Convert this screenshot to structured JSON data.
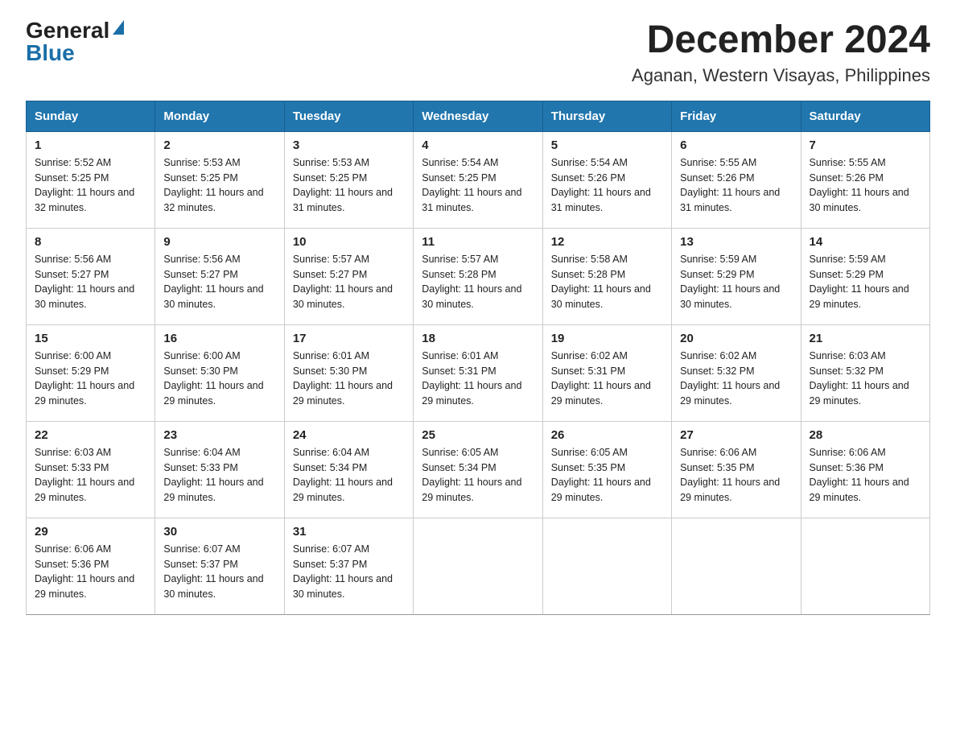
{
  "header": {
    "logo_general": "General",
    "logo_blue": "Blue",
    "title": "December 2024",
    "subtitle": "Aganan, Western Visayas, Philippines"
  },
  "weekdays": [
    "Sunday",
    "Monday",
    "Tuesday",
    "Wednesday",
    "Thursday",
    "Friday",
    "Saturday"
  ],
  "weeks": [
    [
      {
        "day": 1,
        "sunrise": "5:52 AM",
        "sunset": "5:25 PM",
        "daylight": "11 hours and 32 minutes."
      },
      {
        "day": 2,
        "sunrise": "5:53 AM",
        "sunset": "5:25 PM",
        "daylight": "11 hours and 32 minutes."
      },
      {
        "day": 3,
        "sunrise": "5:53 AM",
        "sunset": "5:25 PM",
        "daylight": "11 hours and 31 minutes."
      },
      {
        "day": 4,
        "sunrise": "5:54 AM",
        "sunset": "5:25 PM",
        "daylight": "11 hours and 31 minutes."
      },
      {
        "day": 5,
        "sunrise": "5:54 AM",
        "sunset": "5:26 PM",
        "daylight": "11 hours and 31 minutes."
      },
      {
        "day": 6,
        "sunrise": "5:55 AM",
        "sunset": "5:26 PM",
        "daylight": "11 hours and 31 minutes."
      },
      {
        "day": 7,
        "sunrise": "5:55 AM",
        "sunset": "5:26 PM",
        "daylight": "11 hours and 30 minutes."
      }
    ],
    [
      {
        "day": 8,
        "sunrise": "5:56 AM",
        "sunset": "5:27 PM",
        "daylight": "11 hours and 30 minutes."
      },
      {
        "day": 9,
        "sunrise": "5:56 AM",
        "sunset": "5:27 PM",
        "daylight": "11 hours and 30 minutes."
      },
      {
        "day": 10,
        "sunrise": "5:57 AM",
        "sunset": "5:27 PM",
        "daylight": "11 hours and 30 minutes."
      },
      {
        "day": 11,
        "sunrise": "5:57 AM",
        "sunset": "5:28 PM",
        "daylight": "11 hours and 30 minutes."
      },
      {
        "day": 12,
        "sunrise": "5:58 AM",
        "sunset": "5:28 PM",
        "daylight": "11 hours and 30 minutes."
      },
      {
        "day": 13,
        "sunrise": "5:59 AM",
        "sunset": "5:29 PM",
        "daylight": "11 hours and 30 minutes."
      },
      {
        "day": 14,
        "sunrise": "5:59 AM",
        "sunset": "5:29 PM",
        "daylight": "11 hours and 29 minutes."
      }
    ],
    [
      {
        "day": 15,
        "sunrise": "6:00 AM",
        "sunset": "5:29 PM",
        "daylight": "11 hours and 29 minutes."
      },
      {
        "day": 16,
        "sunrise": "6:00 AM",
        "sunset": "5:30 PM",
        "daylight": "11 hours and 29 minutes."
      },
      {
        "day": 17,
        "sunrise": "6:01 AM",
        "sunset": "5:30 PM",
        "daylight": "11 hours and 29 minutes."
      },
      {
        "day": 18,
        "sunrise": "6:01 AM",
        "sunset": "5:31 PM",
        "daylight": "11 hours and 29 minutes."
      },
      {
        "day": 19,
        "sunrise": "6:02 AM",
        "sunset": "5:31 PM",
        "daylight": "11 hours and 29 minutes."
      },
      {
        "day": 20,
        "sunrise": "6:02 AM",
        "sunset": "5:32 PM",
        "daylight": "11 hours and 29 minutes."
      },
      {
        "day": 21,
        "sunrise": "6:03 AM",
        "sunset": "5:32 PM",
        "daylight": "11 hours and 29 minutes."
      }
    ],
    [
      {
        "day": 22,
        "sunrise": "6:03 AM",
        "sunset": "5:33 PM",
        "daylight": "11 hours and 29 minutes."
      },
      {
        "day": 23,
        "sunrise": "6:04 AM",
        "sunset": "5:33 PM",
        "daylight": "11 hours and 29 minutes."
      },
      {
        "day": 24,
        "sunrise": "6:04 AM",
        "sunset": "5:34 PM",
        "daylight": "11 hours and 29 minutes."
      },
      {
        "day": 25,
        "sunrise": "6:05 AM",
        "sunset": "5:34 PM",
        "daylight": "11 hours and 29 minutes."
      },
      {
        "day": 26,
        "sunrise": "6:05 AM",
        "sunset": "5:35 PM",
        "daylight": "11 hours and 29 minutes."
      },
      {
        "day": 27,
        "sunrise": "6:06 AM",
        "sunset": "5:35 PM",
        "daylight": "11 hours and 29 minutes."
      },
      {
        "day": 28,
        "sunrise": "6:06 AM",
        "sunset": "5:36 PM",
        "daylight": "11 hours and 29 minutes."
      }
    ],
    [
      {
        "day": 29,
        "sunrise": "6:06 AM",
        "sunset": "5:36 PM",
        "daylight": "11 hours and 29 minutes."
      },
      {
        "day": 30,
        "sunrise": "6:07 AM",
        "sunset": "5:37 PM",
        "daylight": "11 hours and 30 minutes."
      },
      {
        "day": 31,
        "sunrise": "6:07 AM",
        "sunset": "5:37 PM",
        "daylight": "11 hours and 30 minutes."
      },
      null,
      null,
      null,
      null
    ]
  ]
}
